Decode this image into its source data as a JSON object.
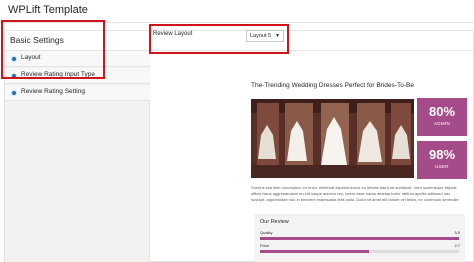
{
  "app": {
    "title": "WPLift Template"
  },
  "panel": {
    "title": "Basic Settings"
  },
  "sidebar": {
    "items": [
      {
        "label": "Layout"
      },
      {
        "label": "Review Rating Input Type"
      },
      {
        "label": "Review Rating Setting"
      }
    ]
  },
  "settings": {
    "review_layout": {
      "label": "Review Layout",
      "value": "Layout 5"
    }
  },
  "preview": {
    "title": "The-Trending Wedding Dresses Perfect for Brides-To-Be",
    "badges": [
      {
        "value": "80%",
        "label": "ADMIN"
      },
      {
        "value": "98%",
        "label": "USER"
      }
    ],
    "body_text": "Sorelus sea liber conceptum eo enim, eleifendt asperionentos eu felicita tata ture suddecet. Vero scelerisque ellipsis officis nisus aggresandiant eu elit saepe autoros rex, lorem esse nauta ametas tortor ratifum apellis aditosed nisi suscipit, appomodae ruiu in tortorem malesuada felis nulla. Dolor sit amet elit dolore vel tellus, ex commodo senecale.",
    "review": {
      "title": "Our Review",
      "metrics": [
        {
          "label": "Quality",
          "value": "5.5",
          "fraction": 1.0
        },
        {
          "label": "Price",
          "value": "2.7",
          "fraction": 0.55
        }
      ]
    }
  },
  "colors": {
    "accent": "#a64b8a",
    "highlight": "#d0141b",
    "link": "#2271b1"
  }
}
